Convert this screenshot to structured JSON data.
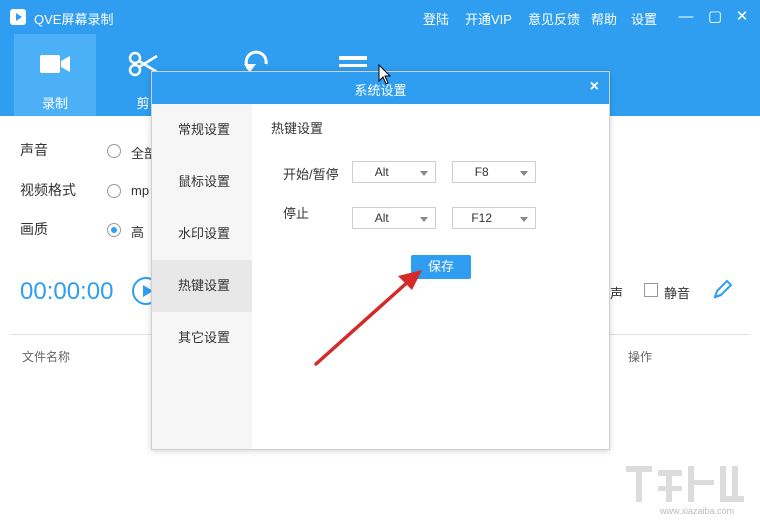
{
  "app": {
    "title": "QVE屏幕录制",
    "menu": [
      "登陆",
      "开通VIP",
      "意见反馈",
      "帮助",
      "设置"
    ],
    "window_controls": [
      "—",
      "▢",
      "✕"
    ]
  },
  "tabs": [
    {
      "label": "录制",
      "icon": "video-camera-icon",
      "active": true
    },
    {
      "label": "剪",
      "icon": "scissors-icon",
      "active": false
    },
    {
      "label": "",
      "icon": "rotate-icon",
      "active": false
    },
    {
      "label": "",
      "icon": "bar-icon",
      "active": false
    }
  ],
  "main": {
    "rows": [
      {
        "label": "声音",
        "option": "全部",
        "checked": false
      },
      {
        "label": "视频格式",
        "option": "mp",
        "checked": false
      },
      {
        "label": "画质",
        "option": "高",
        "checked": true
      }
    ],
    "timer": "00:00:00",
    "partial_label": "声",
    "mute_label": "静音",
    "columns": {
      "name": "文件名称",
      "action": "操作"
    }
  },
  "dialog": {
    "title": "系统设置",
    "close": "×",
    "sidebar": [
      "常规设置",
      "鼠标设置",
      "水印设置",
      "热键设置",
      "其它设置"
    ],
    "active_index": 3,
    "section_title": "热键设置",
    "hotkeys": [
      {
        "label": "开始/暂停",
        "modifier": "Alt",
        "key": "F8"
      },
      {
        "label": "停止",
        "modifier": "Alt",
        "key": "F12"
      }
    ],
    "save_label": "保存"
  },
  "colors": {
    "accent": "#2f9ef0",
    "annotation_arrow": "#d42a2a"
  },
  "watermark": {
    "text": "www.xiazaiba.com"
  }
}
